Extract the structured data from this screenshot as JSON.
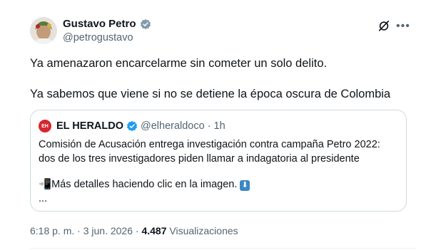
{
  "author": {
    "name": "Gustavo Petro",
    "handle": "@petrogustavo",
    "verified_color": "#829aab"
  },
  "tweet": {
    "line1": "Ya amenazaron encarcelarme sin cometer un solo delito.",
    "line2": "Ya sabemos que viene si no se detiene la época oscura de Colombia"
  },
  "quote": {
    "logo_text": "EH",
    "name": "EL HERALDO",
    "verified_color": "#1d9bf0",
    "handle": "@elheraldoco",
    "separator": "·",
    "time": "1h",
    "line1": "Comisión de Acusación entrega investigación contra campaña Petro 2022:",
    "line2": "dos de los tres investigadores piden llamar a indagatoria al presidente",
    "line3_emoji": "📲",
    "line3_text": "Más detalles haciendo clic en la imagen.",
    "line3_arrow": "⬇",
    "line4": "..."
  },
  "footer": {
    "time": "6:18 p. m.",
    "separator1": "·",
    "date": "3 jun. 2026",
    "separator2": "·",
    "views_count": "4.487",
    "views_label": "Visualizaciones"
  },
  "icons": {
    "grok": "grok-icon",
    "more": "more-icon",
    "verified": "verified-badge-icon"
  }
}
